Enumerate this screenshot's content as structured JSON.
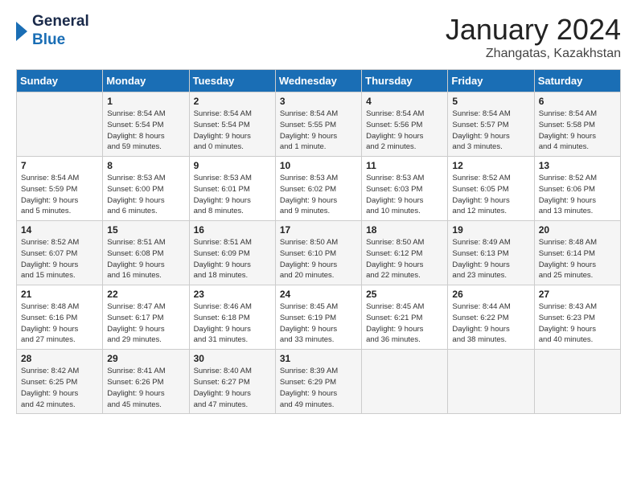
{
  "logo": {
    "general": "General",
    "blue": "Blue"
  },
  "title": "January 2024",
  "subtitle": "Zhangatas, Kazakhstan",
  "headers": [
    "Sunday",
    "Monday",
    "Tuesday",
    "Wednesday",
    "Thursday",
    "Friday",
    "Saturday"
  ],
  "weeks": [
    [
      {
        "num": "",
        "info": ""
      },
      {
        "num": "1",
        "info": "Sunrise: 8:54 AM\nSunset: 5:54 PM\nDaylight: 8 hours\nand 59 minutes."
      },
      {
        "num": "2",
        "info": "Sunrise: 8:54 AM\nSunset: 5:54 PM\nDaylight: 9 hours\nand 0 minutes."
      },
      {
        "num": "3",
        "info": "Sunrise: 8:54 AM\nSunset: 5:55 PM\nDaylight: 9 hours\nand 1 minute."
      },
      {
        "num": "4",
        "info": "Sunrise: 8:54 AM\nSunset: 5:56 PM\nDaylight: 9 hours\nand 2 minutes."
      },
      {
        "num": "5",
        "info": "Sunrise: 8:54 AM\nSunset: 5:57 PM\nDaylight: 9 hours\nand 3 minutes."
      },
      {
        "num": "6",
        "info": "Sunrise: 8:54 AM\nSunset: 5:58 PM\nDaylight: 9 hours\nand 4 minutes."
      }
    ],
    [
      {
        "num": "7",
        "info": "Sunrise: 8:54 AM\nSunset: 5:59 PM\nDaylight: 9 hours\nand 5 minutes."
      },
      {
        "num": "8",
        "info": "Sunrise: 8:53 AM\nSunset: 6:00 PM\nDaylight: 9 hours\nand 6 minutes."
      },
      {
        "num": "9",
        "info": "Sunrise: 8:53 AM\nSunset: 6:01 PM\nDaylight: 9 hours\nand 8 minutes."
      },
      {
        "num": "10",
        "info": "Sunrise: 8:53 AM\nSunset: 6:02 PM\nDaylight: 9 hours\nand 9 minutes."
      },
      {
        "num": "11",
        "info": "Sunrise: 8:53 AM\nSunset: 6:03 PM\nDaylight: 9 hours\nand 10 minutes."
      },
      {
        "num": "12",
        "info": "Sunrise: 8:52 AM\nSunset: 6:05 PM\nDaylight: 9 hours\nand 12 minutes."
      },
      {
        "num": "13",
        "info": "Sunrise: 8:52 AM\nSunset: 6:06 PM\nDaylight: 9 hours\nand 13 minutes."
      }
    ],
    [
      {
        "num": "14",
        "info": "Sunrise: 8:52 AM\nSunset: 6:07 PM\nDaylight: 9 hours\nand 15 minutes."
      },
      {
        "num": "15",
        "info": "Sunrise: 8:51 AM\nSunset: 6:08 PM\nDaylight: 9 hours\nand 16 minutes."
      },
      {
        "num": "16",
        "info": "Sunrise: 8:51 AM\nSunset: 6:09 PM\nDaylight: 9 hours\nand 18 minutes."
      },
      {
        "num": "17",
        "info": "Sunrise: 8:50 AM\nSunset: 6:10 PM\nDaylight: 9 hours\nand 20 minutes."
      },
      {
        "num": "18",
        "info": "Sunrise: 8:50 AM\nSunset: 6:12 PM\nDaylight: 9 hours\nand 22 minutes."
      },
      {
        "num": "19",
        "info": "Sunrise: 8:49 AM\nSunset: 6:13 PM\nDaylight: 9 hours\nand 23 minutes."
      },
      {
        "num": "20",
        "info": "Sunrise: 8:48 AM\nSunset: 6:14 PM\nDaylight: 9 hours\nand 25 minutes."
      }
    ],
    [
      {
        "num": "21",
        "info": "Sunrise: 8:48 AM\nSunset: 6:16 PM\nDaylight: 9 hours\nand 27 minutes."
      },
      {
        "num": "22",
        "info": "Sunrise: 8:47 AM\nSunset: 6:17 PM\nDaylight: 9 hours\nand 29 minutes."
      },
      {
        "num": "23",
        "info": "Sunrise: 8:46 AM\nSunset: 6:18 PM\nDaylight: 9 hours\nand 31 minutes."
      },
      {
        "num": "24",
        "info": "Sunrise: 8:45 AM\nSunset: 6:19 PM\nDaylight: 9 hours\nand 33 minutes."
      },
      {
        "num": "25",
        "info": "Sunrise: 8:45 AM\nSunset: 6:21 PM\nDaylight: 9 hours\nand 36 minutes."
      },
      {
        "num": "26",
        "info": "Sunrise: 8:44 AM\nSunset: 6:22 PM\nDaylight: 9 hours\nand 38 minutes."
      },
      {
        "num": "27",
        "info": "Sunrise: 8:43 AM\nSunset: 6:23 PM\nDaylight: 9 hours\nand 40 minutes."
      }
    ],
    [
      {
        "num": "28",
        "info": "Sunrise: 8:42 AM\nSunset: 6:25 PM\nDaylight: 9 hours\nand 42 minutes."
      },
      {
        "num": "29",
        "info": "Sunrise: 8:41 AM\nSunset: 6:26 PM\nDaylight: 9 hours\nand 45 minutes."
      },
      {
        "num": "30",
        "info": "Sunrise: 8:40 AM\nSunset: 6:27 PM\nDaylight: 9 hours\nand 47 minutes."
      },
      {
        "num": "31",
        "info": "Sunrise: 8:39 AM\nSunset: 6:29 PM\nDaylight: 9 hours\nand 49 minutes."
      },
      {
        "num": "",
        "info": ""
      },
      {
        "num": "",
        "info": ""
      },
      {
        "num": "",
        "info": ""
      }
    ]
  ]
}
